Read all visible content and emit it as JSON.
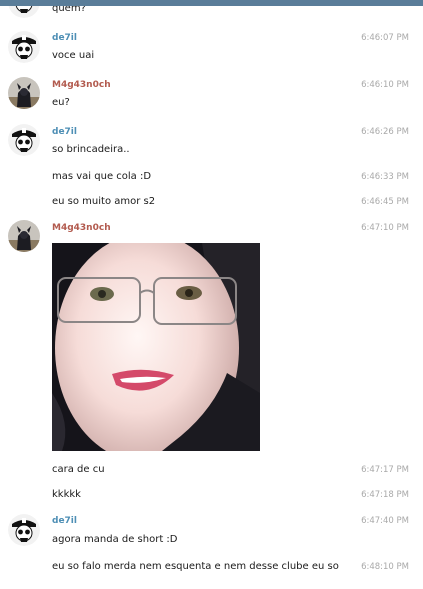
{
  "theme": {
    "accent": "#5a7d99",
    "name_de7il": "#4e8fb5",
    "name_m4g": "#b25a4e",
    "time": "#a9a9a9"
  },
  "messages": {
    "m0": {
      "text": "quem?"
    },
    "m1": {
      "sender": "de7il",
      "time": "6:46:07 PM",
      "text": "voce uai"
    },
    "m2": {
      "sender": "M4g43n0ch",
      "time": "6:46:10 PM",
      "text": "eu?"
    },
    "m3": {
      "sender": "de7il",
      "time": "6:46:26 PM",
      "text": "so brincadeira.."
    },
    "m4": {
      "time": "6:46:33 PM",
      "text": "mas vai que cola :D"
    },
    "m5": {
      "time": "6:46:45 PM",
      "text": "eu so muito amor s2"
    },
    "m6": {
      "sender": "M4g43n0ch",
      "time": "6:47:10 PM"
    },
    "m7": {
      "time": "6:47:17 PM",
      "text": "cara de cu"
    },
    "m8": {
      "time": "6:47:18 PM",
      "text": "kkkkk"
    },
    "m9": {
      "sender": "de7il",
      "time": "6:47:40 PM",
      "text": "agora manda de short :D"
    },
    "m10": {
      "time": "6:48:10 PM",
      "text": "eu so falo merda nem esquenta e nem desse clube eu so"
    }
  },
  "icons": {
    "de7il_avatar": "skull-avatar-icon",
    "m4g_avatar": "dark-figure-avatar-icon"
  }
}
